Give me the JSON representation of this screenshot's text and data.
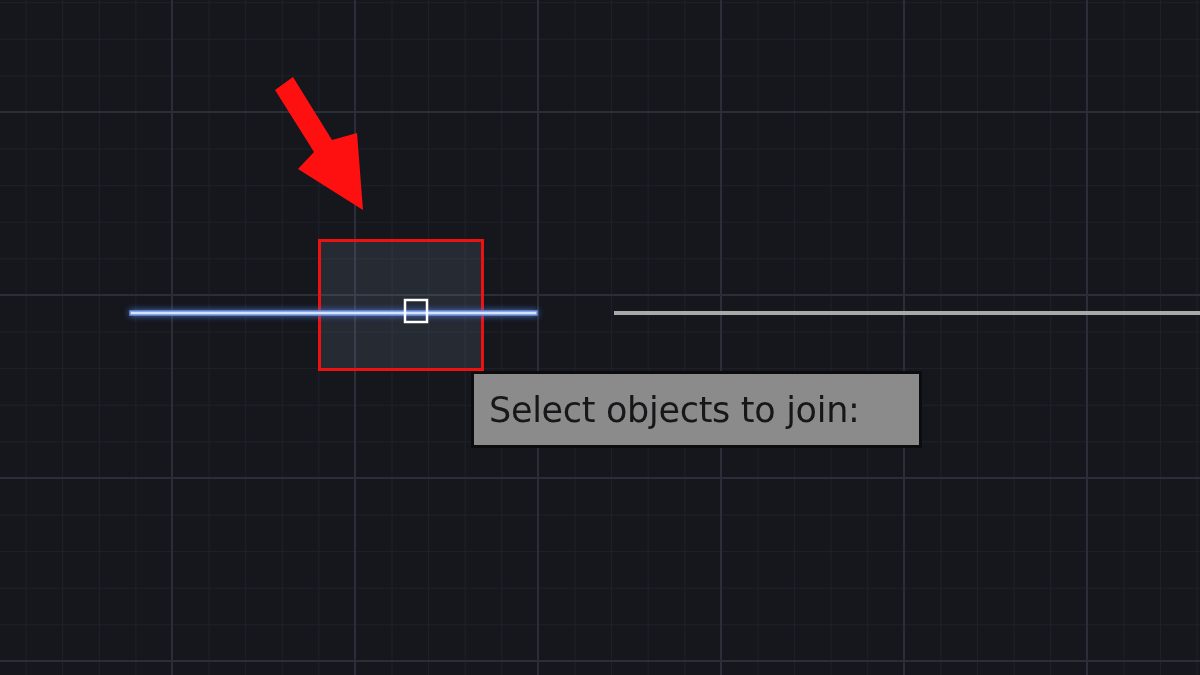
{
  "drawing": {
    "objects": [
      {
        "kind": "line",
        "selected": true
      },
      {
        "kind": "line",
        "selected": false
      }
    ]
  },
  "prompt_tooltip": {
    "text": "Select objects to join:"
  }
}
